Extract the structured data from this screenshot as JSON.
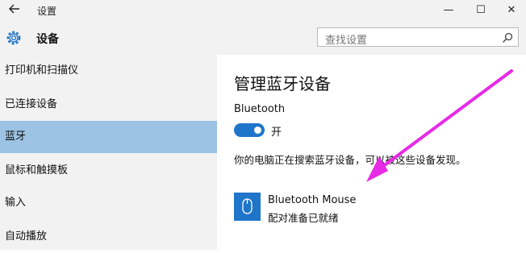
{
  "window": {
    "title": "设置",
    "back_icon": "back-arrow-icon",
    "minimize_glyph": "—",
    "maximize_glyph": "☐",
    "close_glyph": "✕"
  },
  "header": {
    "title": "设备",
    "icon": "gear-icon",
    "search_placeholder": "查找设置"
  },
  "sidebar": {
    "items": [
      {
        "label": "打印机和扫描仪",
        "selected": false
      },
      {
        "label": "已连接设备",
        "selected": false
      },
      {
        "label": "蓝牙",
        "selected": true
      },
      {
        "label": "鼠标和触摸板",
        "selected": false
      },
      {
        "label": "输入",
        "selected": false
      },
      {
        "label": "自动播放",
        "selected": false
      }
    ]
  },
  "main": {
    "title": "管理蓝牙设备",
    "bluetooth_label": "Bluetooth",
    "toggle_state": "开",
    "toggle_on": true,
    "status_text": "你的电脑正在搜索蓝牙设备，可以被这些设备发现。",
    "device": {
      "name": "Bluetooth Mouse",
      "status": "配对准备已就绪",
      "icon": "mouse-icon"
    }
  },
  "colors": {
    "accent": "#1f75c9",
    "selected_nav": "#9cc3e3",
    "annotation_arrow": "#e62ae6"
  }
}
